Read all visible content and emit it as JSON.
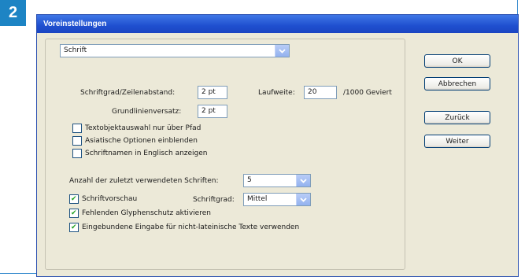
{
  "step_badge": "2",
  "dialog": {
    "title": "Voreinstellungen",
    "category_select": "Schrift",
    "fields": {
      "schriftgrad_label": "Schriftgrad/Zeilenabstand:",
      "schriftgrad_value": "2 pt",
      "laufweite_label": "Laufweite:",
      "laufweite_value": "20",
      "laufweite_unit": "/1000 Geviert",
      "grundlinie_label": "Grundlinienversatz:",
      "grundlinie_value": "2 pt"
    },
    "checkboxes": [
      {
        "label": "Textobjektauswahl nur über Pfad",
        "checked": false
      },
      {
        "label": "Asiatische Optionen einblenden",
        "checked": false
      },
      {
        "label": "Schriftnamen in Englisch anzeigen",
        "checked": false
      }
    ],
    "recent_fonts": {
      "label": "Anzahl der zuletzt verwendeten Schriften:",
      "value": "5"
    },
    "preview": {
      "checkbox_label": "Schriftvorschau",
      "checked": true,
      "size_label": "Schriftgrad:",
      "size_value": "Mittel"
    },
    "checkboxes2": [
      {
        "label": "Fehlenden Glyphenschutz aktivieren",
        "checked": true
      },
      {
        "label": "Eingebundene Eingabe für nicht-lateinische Texte verwenden",
        "checked": true
      }
    ],
    "buttons": {
      "ok": "OK",
      "cancel": "Abbrechen",
      "back": "Zurück",
      "next": "Weiter"
    }
  }
}
